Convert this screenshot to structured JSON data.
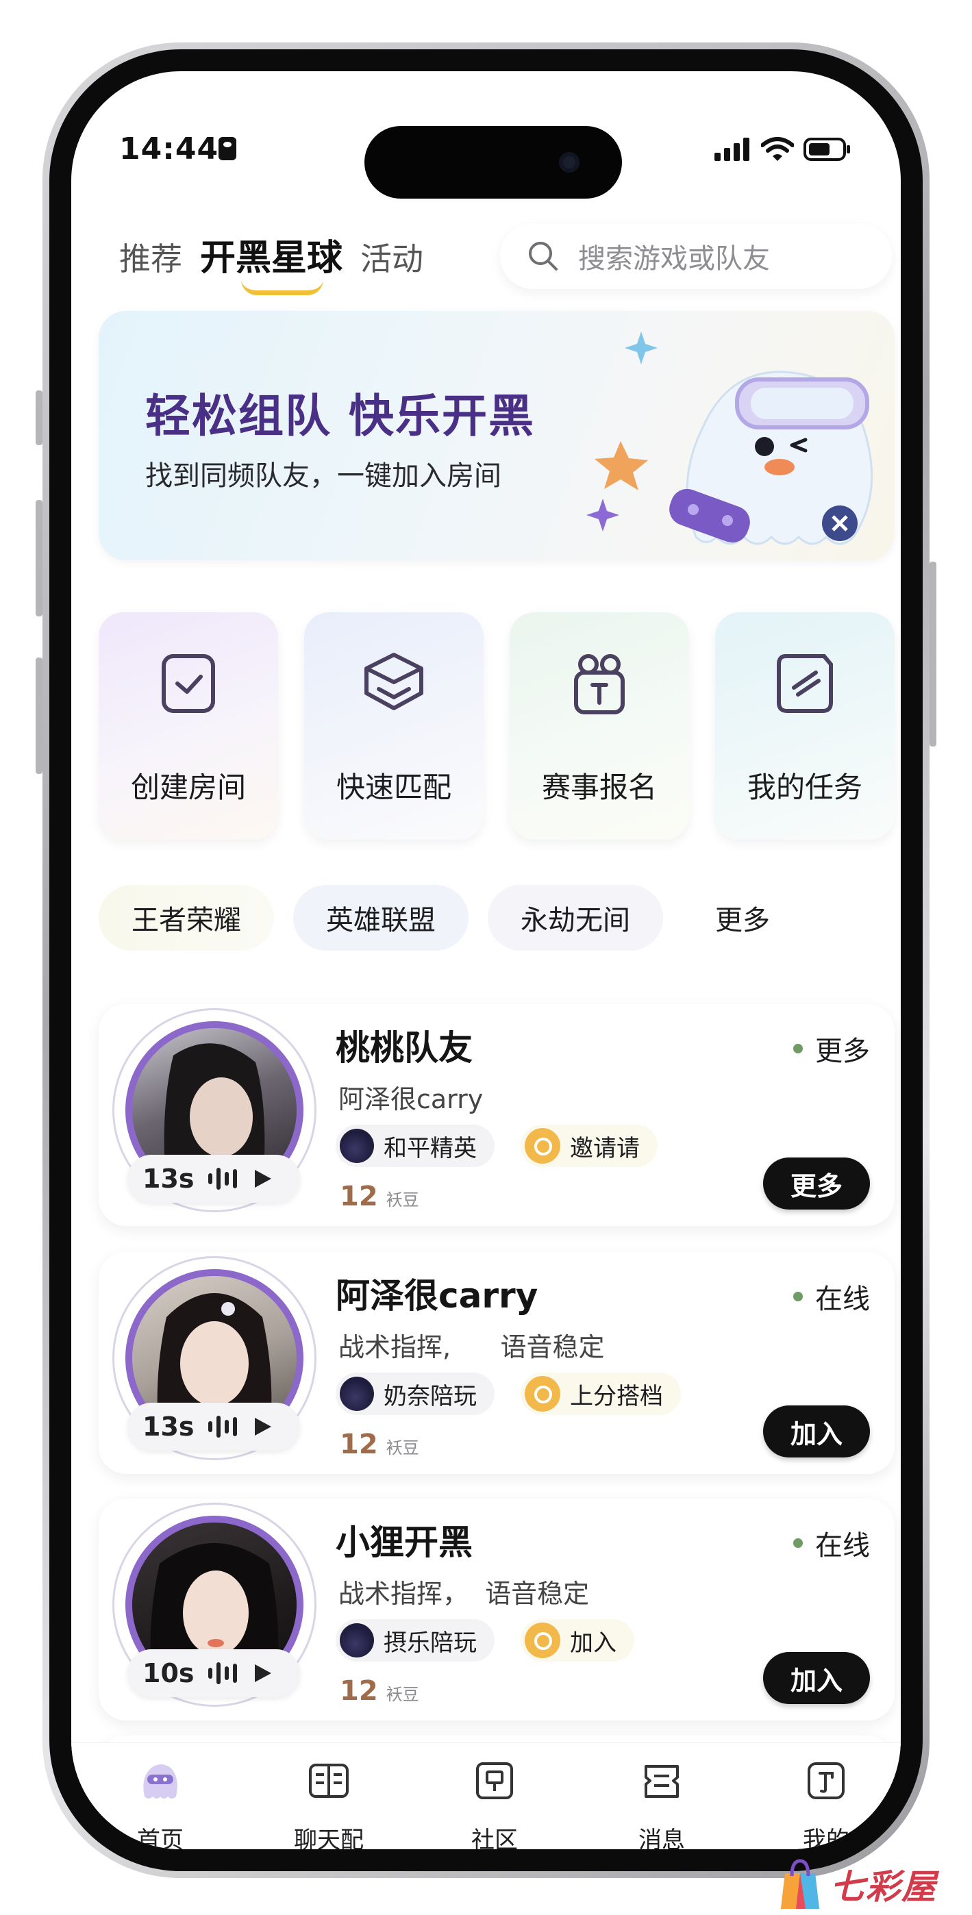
{
  "status_bar": {
    "time": "14:44"
  },
  "top_nav": {
    "tabs": [
      {
        "label": "推荐",
        "active": false
      },
      {
        "label": "开黑星球",
        "active": true
      },
      {
        "label": "活动",
        "active": false
      }
    ],
    "search_placeholder": "搜索游戏或队友"
  },
  "banner": {
    "title": "轻松组队 快乐开黑",
    "subtitle": "找到同频队友，一键加入房间"
  },
  "quick_actions": [
    {
      "label": "创建房间",
      "icon": "create-room-icon"
    },
    {
      "label": "快速匹配",
      "icon": "quick-match-icon"
    },
    {
      "label": "赛事报名",
      "icon": "tournament-icon"
    },
    {
      "label": "我的任务",
      "icon": "task-icon"
    }
  ],
  "game_chips": [
    "王者荣耀",
    "英雄联盟",
    "永劫无间",
    "更多"
  ],
  "cards": [
    {
      "name": "桃桃队友",
      "desc": "阿泽很carry",
      "status": "更多",
      "voice_seconds": "13s",
      "game_tag": "和平精英",
      "coin_tag": "邀请请",
      "count": "12",
      "count_unit": "袄豆",
      "button": "更多"
    },
    {
      "name": "阿泽很carry",
      "desc": "战术指挥,      语音稳定",
      "status": "在线",
      "voice_seconds": "13s",
      "game_tag": "奶奈陪玩",
      "coin_tag": "上分搭档",
      "count": "12",
      "count_unit": "袄豆",
      "button": "加入"
    },
    {
      "name": "小狸开黑",
      "desc": "战术指挥，  语音稳定",
      "status": "在线",
      "voice_seconds": "10s",
      "game_tag": "摂乐陪玩",
      "coin_tag": "加入",
      "count": "12",
      "count_unit": "袄豆",
      "button": "加入"
    }
  ],
  "bottom_tabs": [
    {
      "label": "首页",
      "icon": "home-mascot-icon",
      "active": true
    },
    {
      "label": "聊天配",
      "icon": "chat-book-icon",
      "active": false
    },
    {
      "label": "社区",
      "icon": "community-icon",
      "active": false
    },
    {
      "label": "消息",
      "icon": "message-icon",
      "active": false
    },
    {
      "label": "我的",
      "icon": "profile-icon",
      "active": false
    }
  ],
  "watermark": "七彩屋",
  "colors": {
    "accent_purple": "#4a2f86",
    "ring_purple": "#8b68c9",
    "highlight_yellow": "#f2c037",
    "online_green": "#6e9c64",
    "button_black": "#111111",
    "coin_orange": "#f2b94a"
  }
}
